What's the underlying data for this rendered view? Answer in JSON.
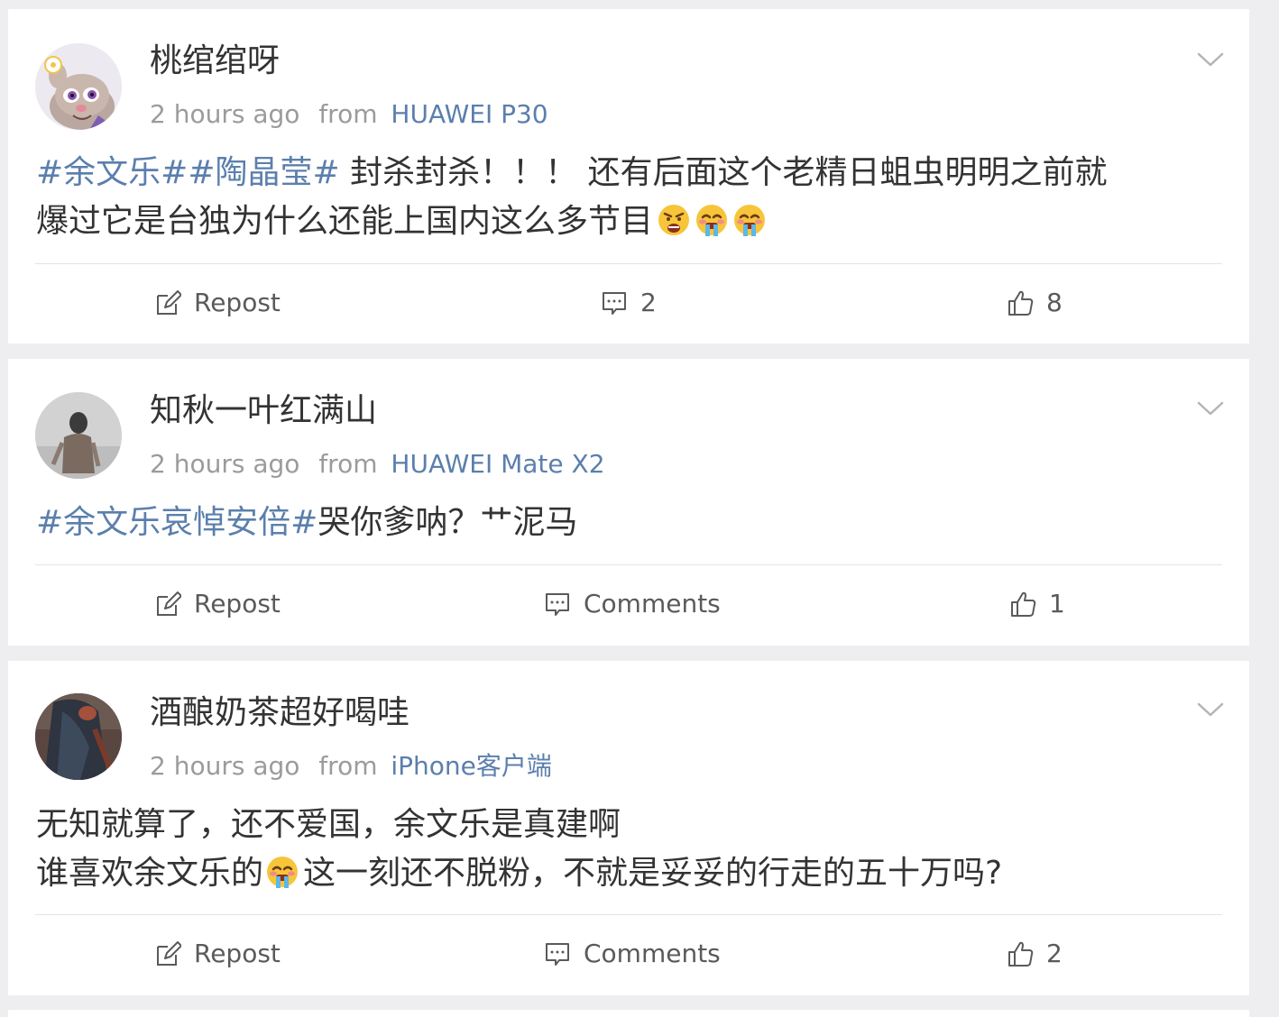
{
  "posts": [
    {
      "username": "桃绾绾呀",
      "time": "2 hours ago",
      "from_label": "from",
      "device": "HUAWEI P30",
      "body_lines": [
        {
          "topic": "#余文乐##陶晶莹#",
          "text": " 封杀封杀！！！ 还有后面这个老精日蛆虫明明之前就"
        },
        {
          "text": "爆过它是台独为什么还能上国内这么多节目"
        }
      ],
      "emojis": [
        "angry-shout-emoji",
        "crying-emoji",
        "crying-emoji"
      ],
      "actions": {
        "repost": "Repost",
        "comments": "2",
        "likes": "8"
      }
    },
    {
      "username": "知秋一叶红满山",
      "time": "2 hours ago",
      "from_label": "from",
      "device": "HUAWEI Mate X2",
      "body_lines": [
        {
          "topic": "#余文乐哀悼安倍#",
          "text": "哭你爹呐？艹泥马"
        }
      ],
      "actions": {
        "repost": "Repost",
        "comments": "Comments",
        "likes": "1"
      }
    },
    {
      "username": "酒酿奶茶超好喝哇",
      "time": "2 hours ago",
      "from_label": "from",
      "device": "iPhone客户端",
      "body_lines": [
        {
          "text": "无知就算了，还不爱国，余文乐是真建啊"
        },
        {
          "text_a": "谁喜欢余文乐的",
          "text_b": "这一刻还不脱粉，不就是妥妥的行走的五十万吗?"
        }
      ],
      "actions": {
        "repost": "Repost",
        "comments": "Comments",
        "likes": "2"
      }
    }
  ],
  "colors": {
    "link": "#5b7fad",
    "text": "#333333",
    "meta": "#9b9b9b",
    "background": "#eeeef0"
  }
}
